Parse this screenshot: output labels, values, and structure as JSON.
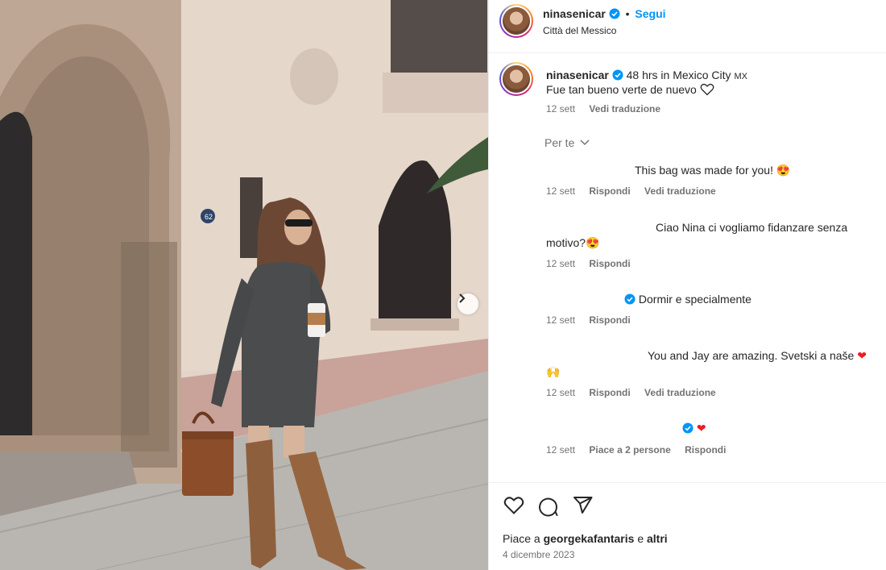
{
  "post": {
    "username": "ninasenicar",
    "follow_label": "Segui",
    "location": "Città del Messico",
    "caption_title": "48 hrs in Mexico City",
    "caption_flag": "MX",
    "caption_text": "Fue tan bueno verte de nuevo",
    "caption_age": "12 sett",
    "caption_translate": "Vedi traduzione",
    "building_number": "62"
  },
  "comments_filter": "Per te",
  "comments": [
    {
      "text": "This bag was made for you!",
      "emoji": "😍",
      "age": "12 sett",
      "reply": "Rispondi",
      "translate": "Vedi traduzione"
    },
    {
      "text_line1": "Ciao Nina ci vogliamo fidanzare senza",
      "text_line2": "motivo?",
      "emoji": "😍",
      "age": "12 sett",
      "reply": "Rispondi"
    },
    {
      "text": "Dormir e specialmente",
      "age": "12 sett",
      "reply": "Rispondi"
    },
    {
      "text": "You and Jay are amazing. Svetski a naše",
      "emoji": "❤",
      "emoji2": "🙌",
      "age": "12 sett",
      "reply": "Rispondi",
      "translate": "Vedi traduzione"
    },
    {
      "emoji": "❤",
      "age": "12 sett",
      "likes": "Piace a 2 persone",
      "reply": "Rispondi"
    }
  ],
  "footer": {
    "likes_prefix": "Piace a",
    "likes_user": "georgekafantaris",
    "likes_and": "e",
    "likes_others": "altri",
    "date": "4 dicembre 2023"
  },
  "colors": {
    "link_blue": "#0095f6",
    "verified_blue": "#0095f6",
    "heart_red": "#ed1c24",
    "meta_gray": "#737373"
  }
}
